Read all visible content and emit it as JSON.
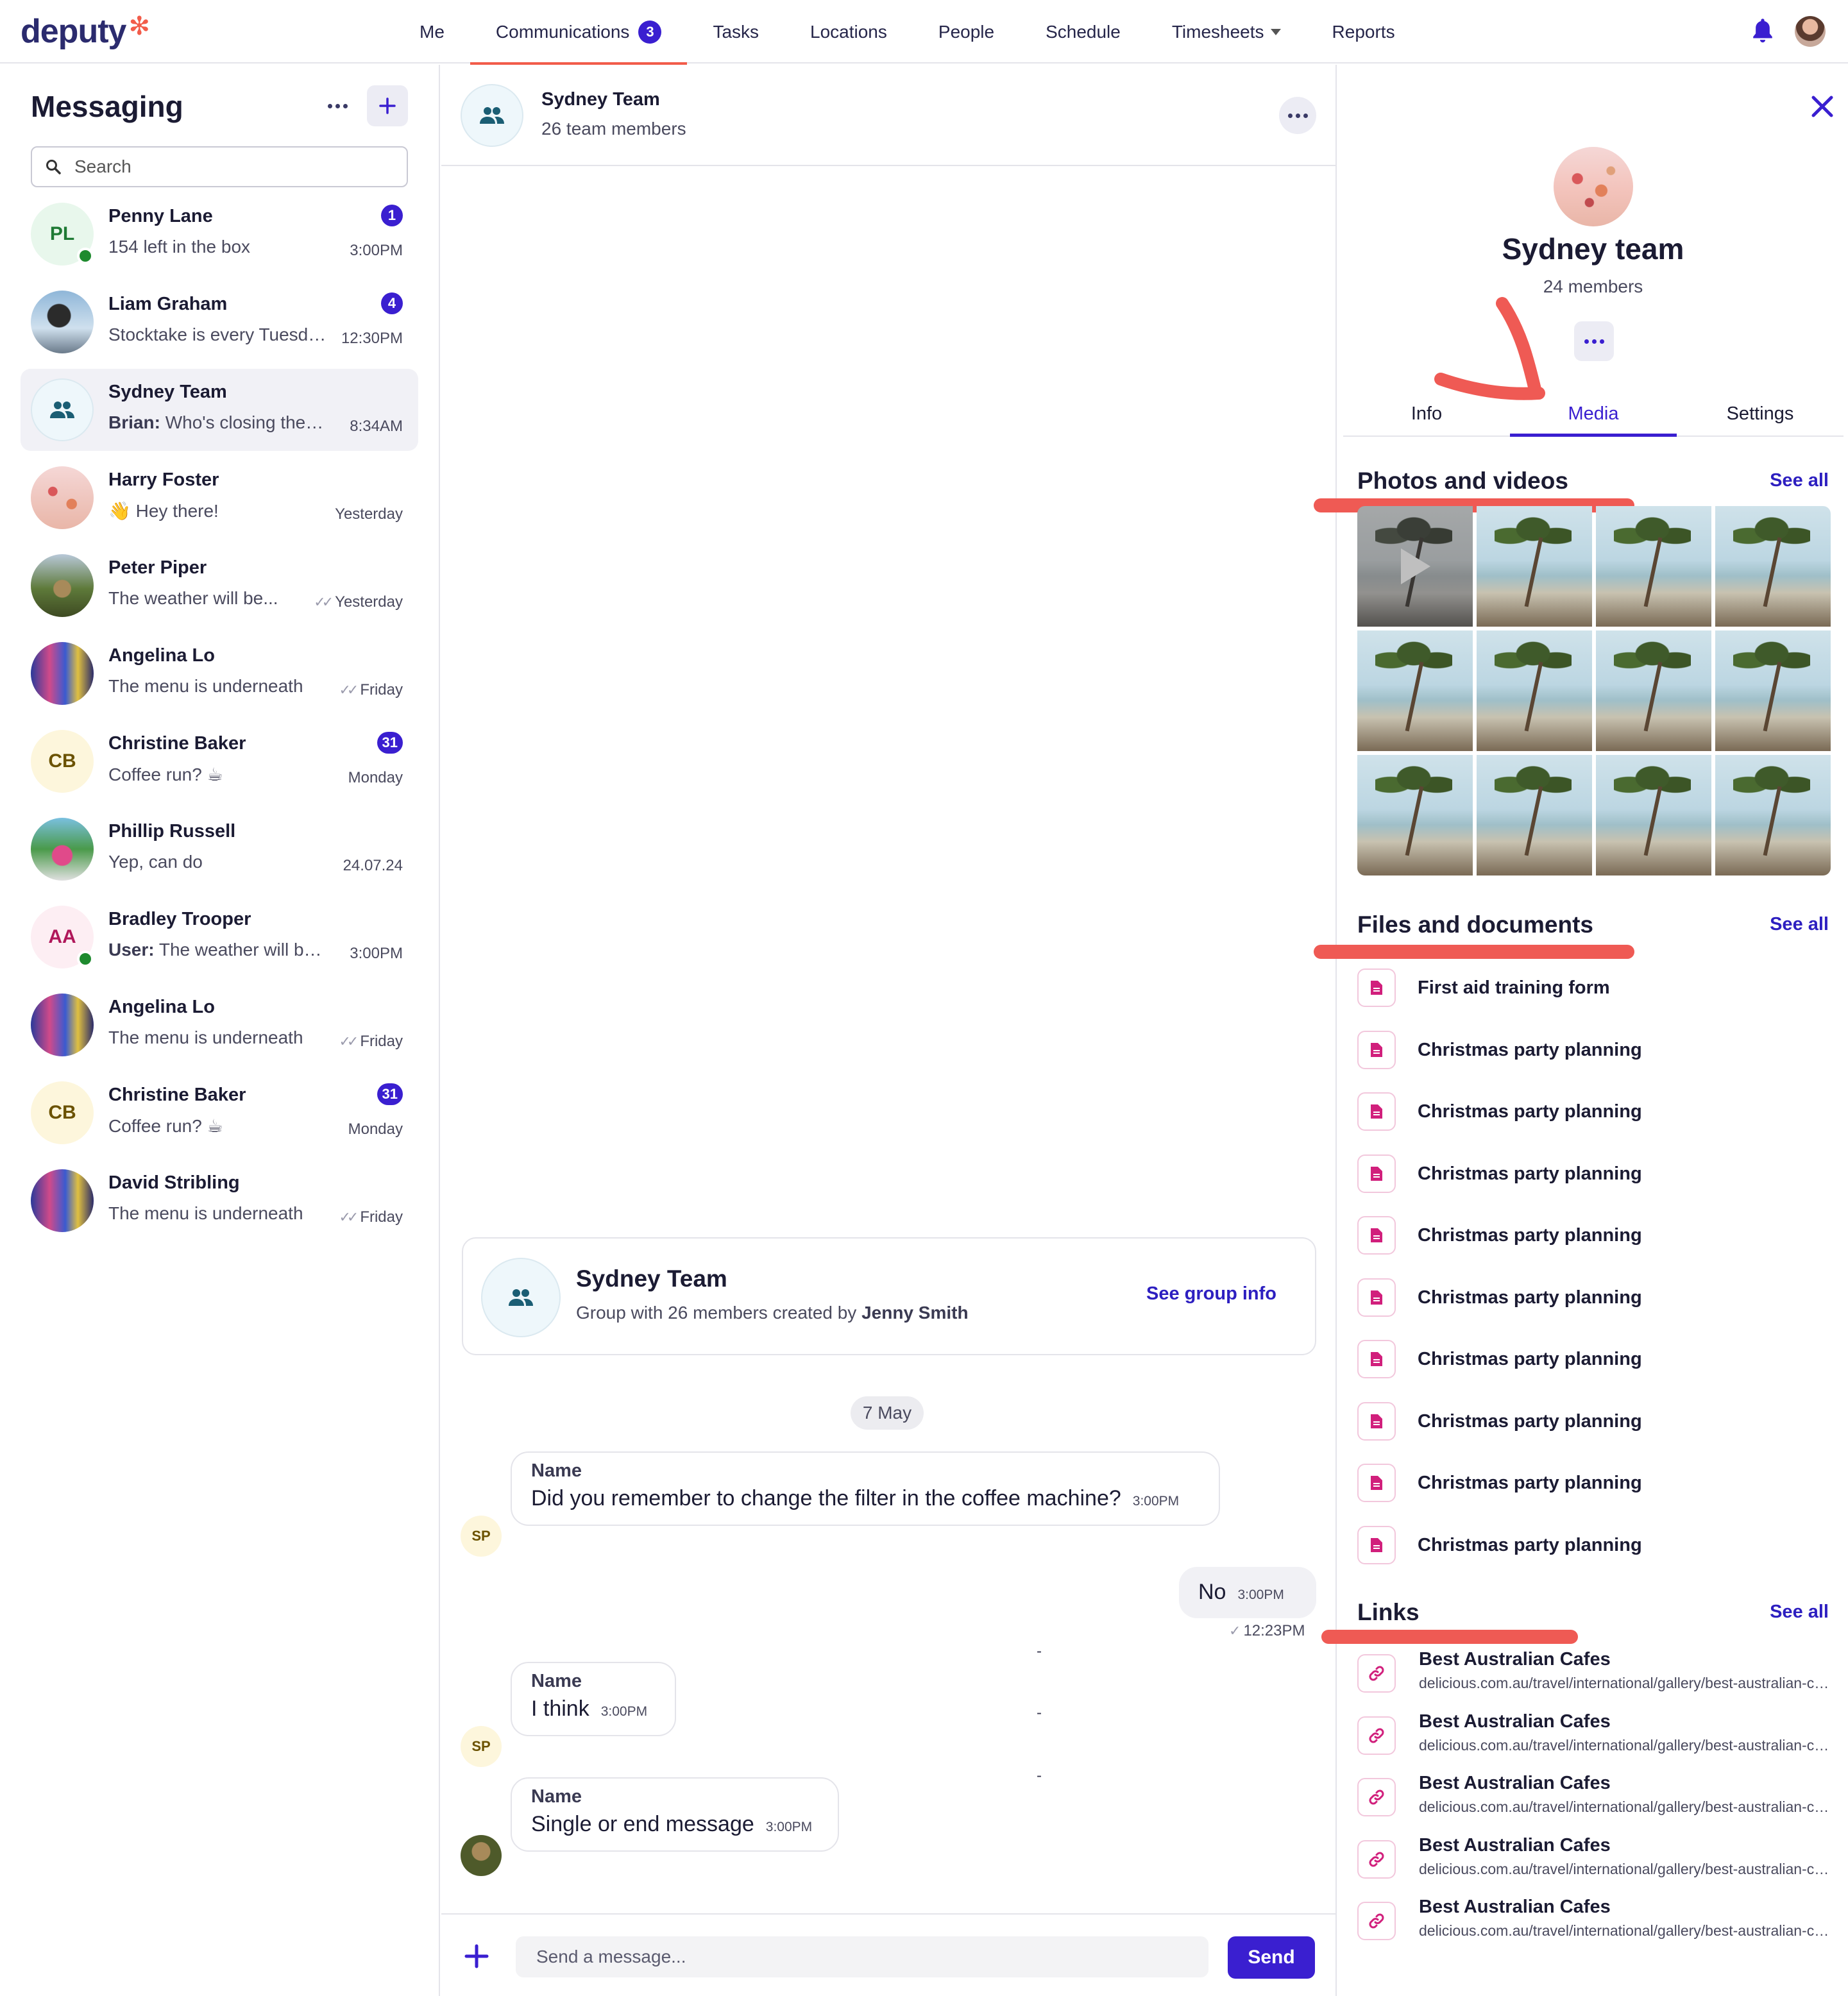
{
  "brand": {
    "logo_text": "deputy",
    "accent": "#3a1fd0",
    "highlight": "#f25c4a"
  },
  "nav": {
    "items": [
      {
        "label": "Me"
      },
      {
        "label": "Communications",
        "badge": "3",
        "active": true
      },
      {
        "label": "Tasks"
      },
      {
        "label": "Locations"
      },
      {
        "label": "People"
      },
      {
        "label": "Schedule"
      },
      {
        "label": "Timesheets",
        "dropdown": true
      },
      {
        "label": "Reports"
      }
    ],
    "icons": [
      "bell-icon",
      "user-avatar"
    ]
  },
  "sidebar": {
    "title": "Messaging",
    "search_placeholder": "Search",
    "conversations": [
      {
        "name": "Penny Lane",
        "initials": "PL",
        "preview": "154 left in the box",
        "time": "3:00PM",
        "badge": "1",
        "online": true,
        "avatar_bg": "#e8f7ec",
        "avatar_fg": "#1e7a34"
      },
      {
        "name": "Liam Graham",
        "preview": "Stocktake is every Tuesday",
        "time": "12:30PM",
        "badge": "4",
        "photo": "photo-a"
      },
      {
        "name": "Sydney Team",
        "sender": "Brian:",
        "preview": "Who's closing the store",
        "time": "8:34AM",
        "group": true,
        "selected": true
      },
      {
        "name": "Harry Foster",
        "preview": "👋 Hey there!",
        "time": "Yesterday",
        "photo": "photo-b"
      },
      {
        "name": "Peter Piper",
        "preview": "The weather will be...",
        "time": "Yesterday",
        "read": true,
        "photo": "photo-c"
      },
      {
        "name": "Angelina Lo",
        "preview": "The menu is underneath",
        "time": "Friday",
        "read": true,
        "photo": "photo-d"
      },
      {
        "name": "Christine Baker",
        "initials": "CB",
        "preview": "Coffee run? ☕",
        "time": "Monday",
        "badge": "31",
        "avatar_bg": "#fdf6dc",
        "avatar_fg": "#6b5200"
      },
      {
        "name": "Phillip Russell",
        "preview": "Yep, can do",
        "time": "24.07.24",
        "photo": "photo-e"
      },
      {
        "name": "Bradley Trooper",
        "initials": "AA",
        "sender": "User:",
        "preview": "The weather will be nice",
        "time": "3:00PM",
        "online": true,
        "avatar_bg": "#fdeef3",
        "avatar_fg": "#b0175a"
      },
      {
        "name": "Angelina Lo",
        "preview": "The menu is underneath",
        "time": "Friday",
        "read": true,
        "photo": "photo-d"
      },
      {
        "name": "Christine Baker",
        "initials": "CB",
        "preview": "Coffee run? ☕",
        "time": "Monday",
        "badge": "31",
        "avatar_bg": "#fdf6dc",
        "avatar_fg": "#6b5200"
      },
      {
        "name": "David Stribling",
        "preview": "The menu is underneath",
        "time": "Friday",
        "read": true,
        "photo": "photo-d"
      }
    ]
  },
  "chat": {
    "title": "Sydney Team",
    "subtitle": "26 team members",
    "group_card": {
      "title": "Sydney Team",
      "subtitle_prefix": "Group with 26 members created by",
      "creator": "Jenny Smith",
      "link": "See group info"
    },
    "date_divider": "7 May",
    "messages": [
      {
        "author": "Name",
        "initials": "SP",
        "text": "Did you remember to change the filter in the coffee machine?",
        "time": "3:00PM"
      },
      {
        "outgoing": true,
        "text": "No",
        "time": "3:00PM",
        "read_time": "12:23PM"
      },
      {
        "author": "Name",
        "initials": "SP",
        "text": "I think",
        "time": "3:00PM"
      },
      {
        "author": "Name",
        "text": "Single or end message",
        "time": "3:00PM",
        "photo": true
      }
    ],
    "dash_marker": "-",
    "composer": {
      "placeholder": "Send a message...",
      "send_label": "Send"
    }
  },
  "panel": {
    "title": "Sydney team",
    "subtitle": "24 members",
    "tabs": [
      {
        "label": "Info"
      },
      {
        "label": "Media",
        "active": true
      },
      {
        "label": "Settings"
      }
    ],
    "media": {
      "title": "Photos and videos",
      "see_all": "See all",
      "count": 12,
      "video_index": 0
    },
    "files": {
      "title": "Files and documents",
      "see_all": "See all",
      "items": [
        "First aid training form",
        "Christmas party planning",
        "Christmas party planning",
        "Christmas party planning",
        "Christmas party planning",
        "Christmas party planning",
        "Christmas party planning",
        "Christmas party planning",
        "Christmas party planning",
        "Christmas party planning"
      ]
    },
    "links": {
      "title": "Links",
      "see_all": "See all",
      "items": [
        {
          "title": "Best Australian Cafes",
          "url": "delicious.com.au/travel/international/gallery/best-australian-cafes"
        },
        {
          "title": "Best Australian Cafes",
          "url": "delicious.com.au/travel/international/gallery/best-australian-cafes"
        },
        {
          "title": "Best Australian Cafes",
          "url": "delicious.com.au/travel/international/gallery/best-australian-cafes"
        },
        {
          "title": "Best Australian Cafes",
          "url": "delicious.com.au/travel/international/gallery/best-australian-cafes"
        },
        {
          "title": "Best Australian Cafes",
          "url": "delicious.com.au/travel/international/gallery/best-australian-cafes"
        }
      ]
    }
  }
}
